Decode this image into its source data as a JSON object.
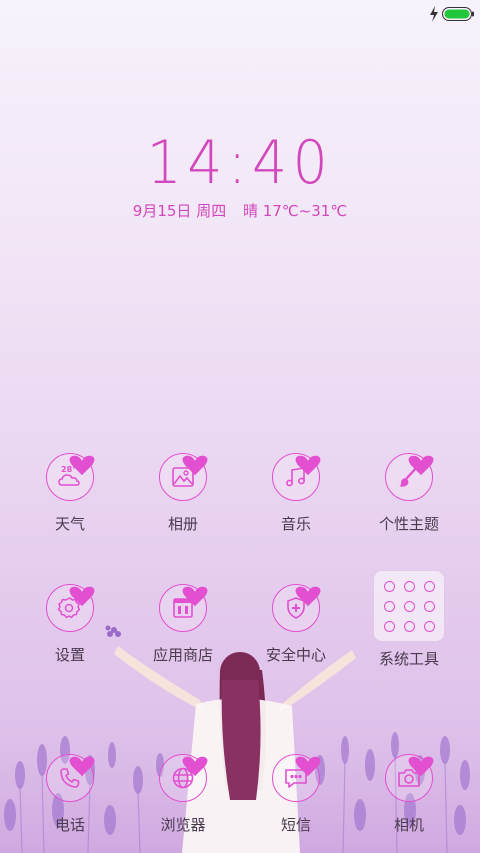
{
  "status": {
    "charging": true,
    "battery_color": "#22c63a"
  },
  "clock": {
    "time": "14:40",
    "date": "9月15日 周四",
    "weather": "晴 17℃~31℃"
  },
  "apps": {
    "row1": [
      {
        "label": "天气",
        "icon": "weather-icon",
        "temp": "28°"
      },
      {
        "label": "相册",
        "icon": "gallery-icon"
      },
      {
        "label": "音乐",
        "icon": "music-icon"
      },
      {
        "label": "个性主题",
        "icon": "theme-brush-icon"
      }
    ],
    "row2": [
      {
        "label": "设置",
        "icon": "settings-gear-icon"
      },
      {
        "label": "应用商店",
        "icon": "app-store-icon"
      },
      {
        "label": "安全中心",
        "icon": "security-shield-icon"
      },
      {
        "label": "系统工具",
        "icon": "folder-icon"
      }
    ],
    "dock": [
      {
        "label": "电话",
        "icon": "phone-icon"
      },
      {
        "label": "浏览器",
        "icon": "browser-globe-icon"
      },
      {
        "label": "短信",
        "icon": "message-icon"
      },
      {
        "label": "相机",
        "icon": "camera-icon"
      }
    ]
  },
  "colors": {
    "accent": "#e24fd0",
    "clock": "#d347bd"
  }
}
